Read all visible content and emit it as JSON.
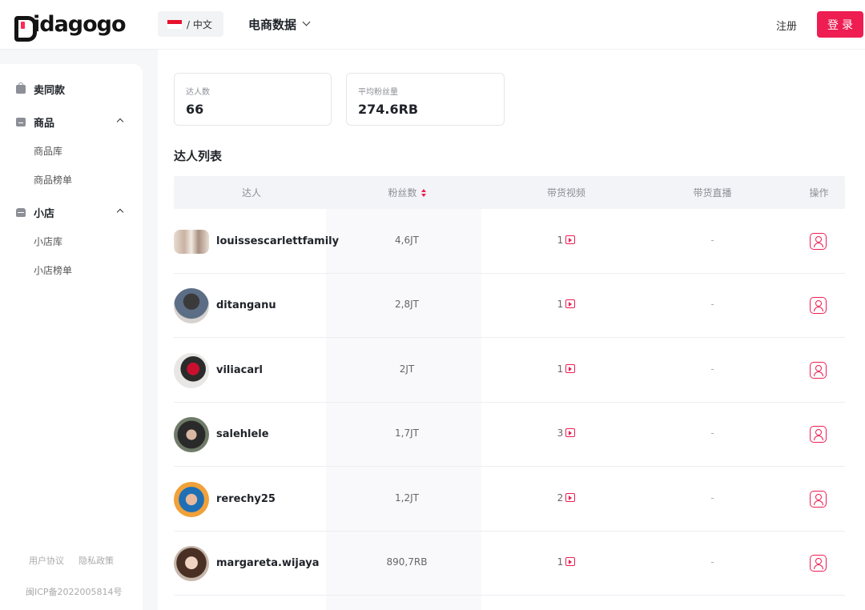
{
  "header": {
    "logo_text": "idagogo",
    "language": {
      "label": "/ 中文",
      "flag_colors": [
        "#e8112d",
        "#ffffff"
      ]
    },
    "nav_menu_label": "电商数据",
    "register_label": "注册",
    "login_label": "登录",
    "accent_color": "#ee1d52"
  },
  "sidebar": {
    "items": [
      {
        "label": "卖同款",
        "icon": "bag-icon"
      },
      {
        "label": "商品",
        "icon": "box-icon",
        "expanded": true,
        "children": [
          "商品库",
          "商品榜单"
        ]
      },
      {
        "label": "小店",
        "icon": "store-icon",
        "expanded": true,
        "children": [
          "小店库",
          "小店榜单"
        ]
      }
    ],
    "footer_links": [
      "用户协议",
      "隐私政策"
    ],
    "icp": "闽ICP备2022005814号"
  },
  "stats": [
    {
      "label": "达人数",
      "value": "66"
    },
    {
      "label": "平均粉丝量",
      "value": "274.6RB"
    }
  ],
  "section_title": "达人列表",
  "table": {
    "columns": [
      "达人",
      "粉丝数",
      "带货视频",
      "带货直播",
      "操作"
    ],
    "rows": [
      {
        "name": "louissescarlettfamily",
        "fans": "4,6JT",
        "videos": "1",
        "live": "-"
      },
      {
        "name": "ditanganu",
        "fans": "2,8JT",
        "videos": "1",
        "live": "-"
      },
      {
        "name": "viliacarl",
        "fans": "2JT",
        "videos": "1",
        "live": "-"
      },
      {
        "name": "salehlele",
        "fans": "1,7JT",
        "videos": "3",
        "live": "-"
      },
      {
        "name": "rerechy25",
        "fans": "1,2JT",
        "videos": "2",
        "live": "-"
      },
      {
        "name": "margareta.wijaya",
        "fans": "890,7RB",
        "videos": "1",
        "live": "-"
      }
    ]
  }
}
